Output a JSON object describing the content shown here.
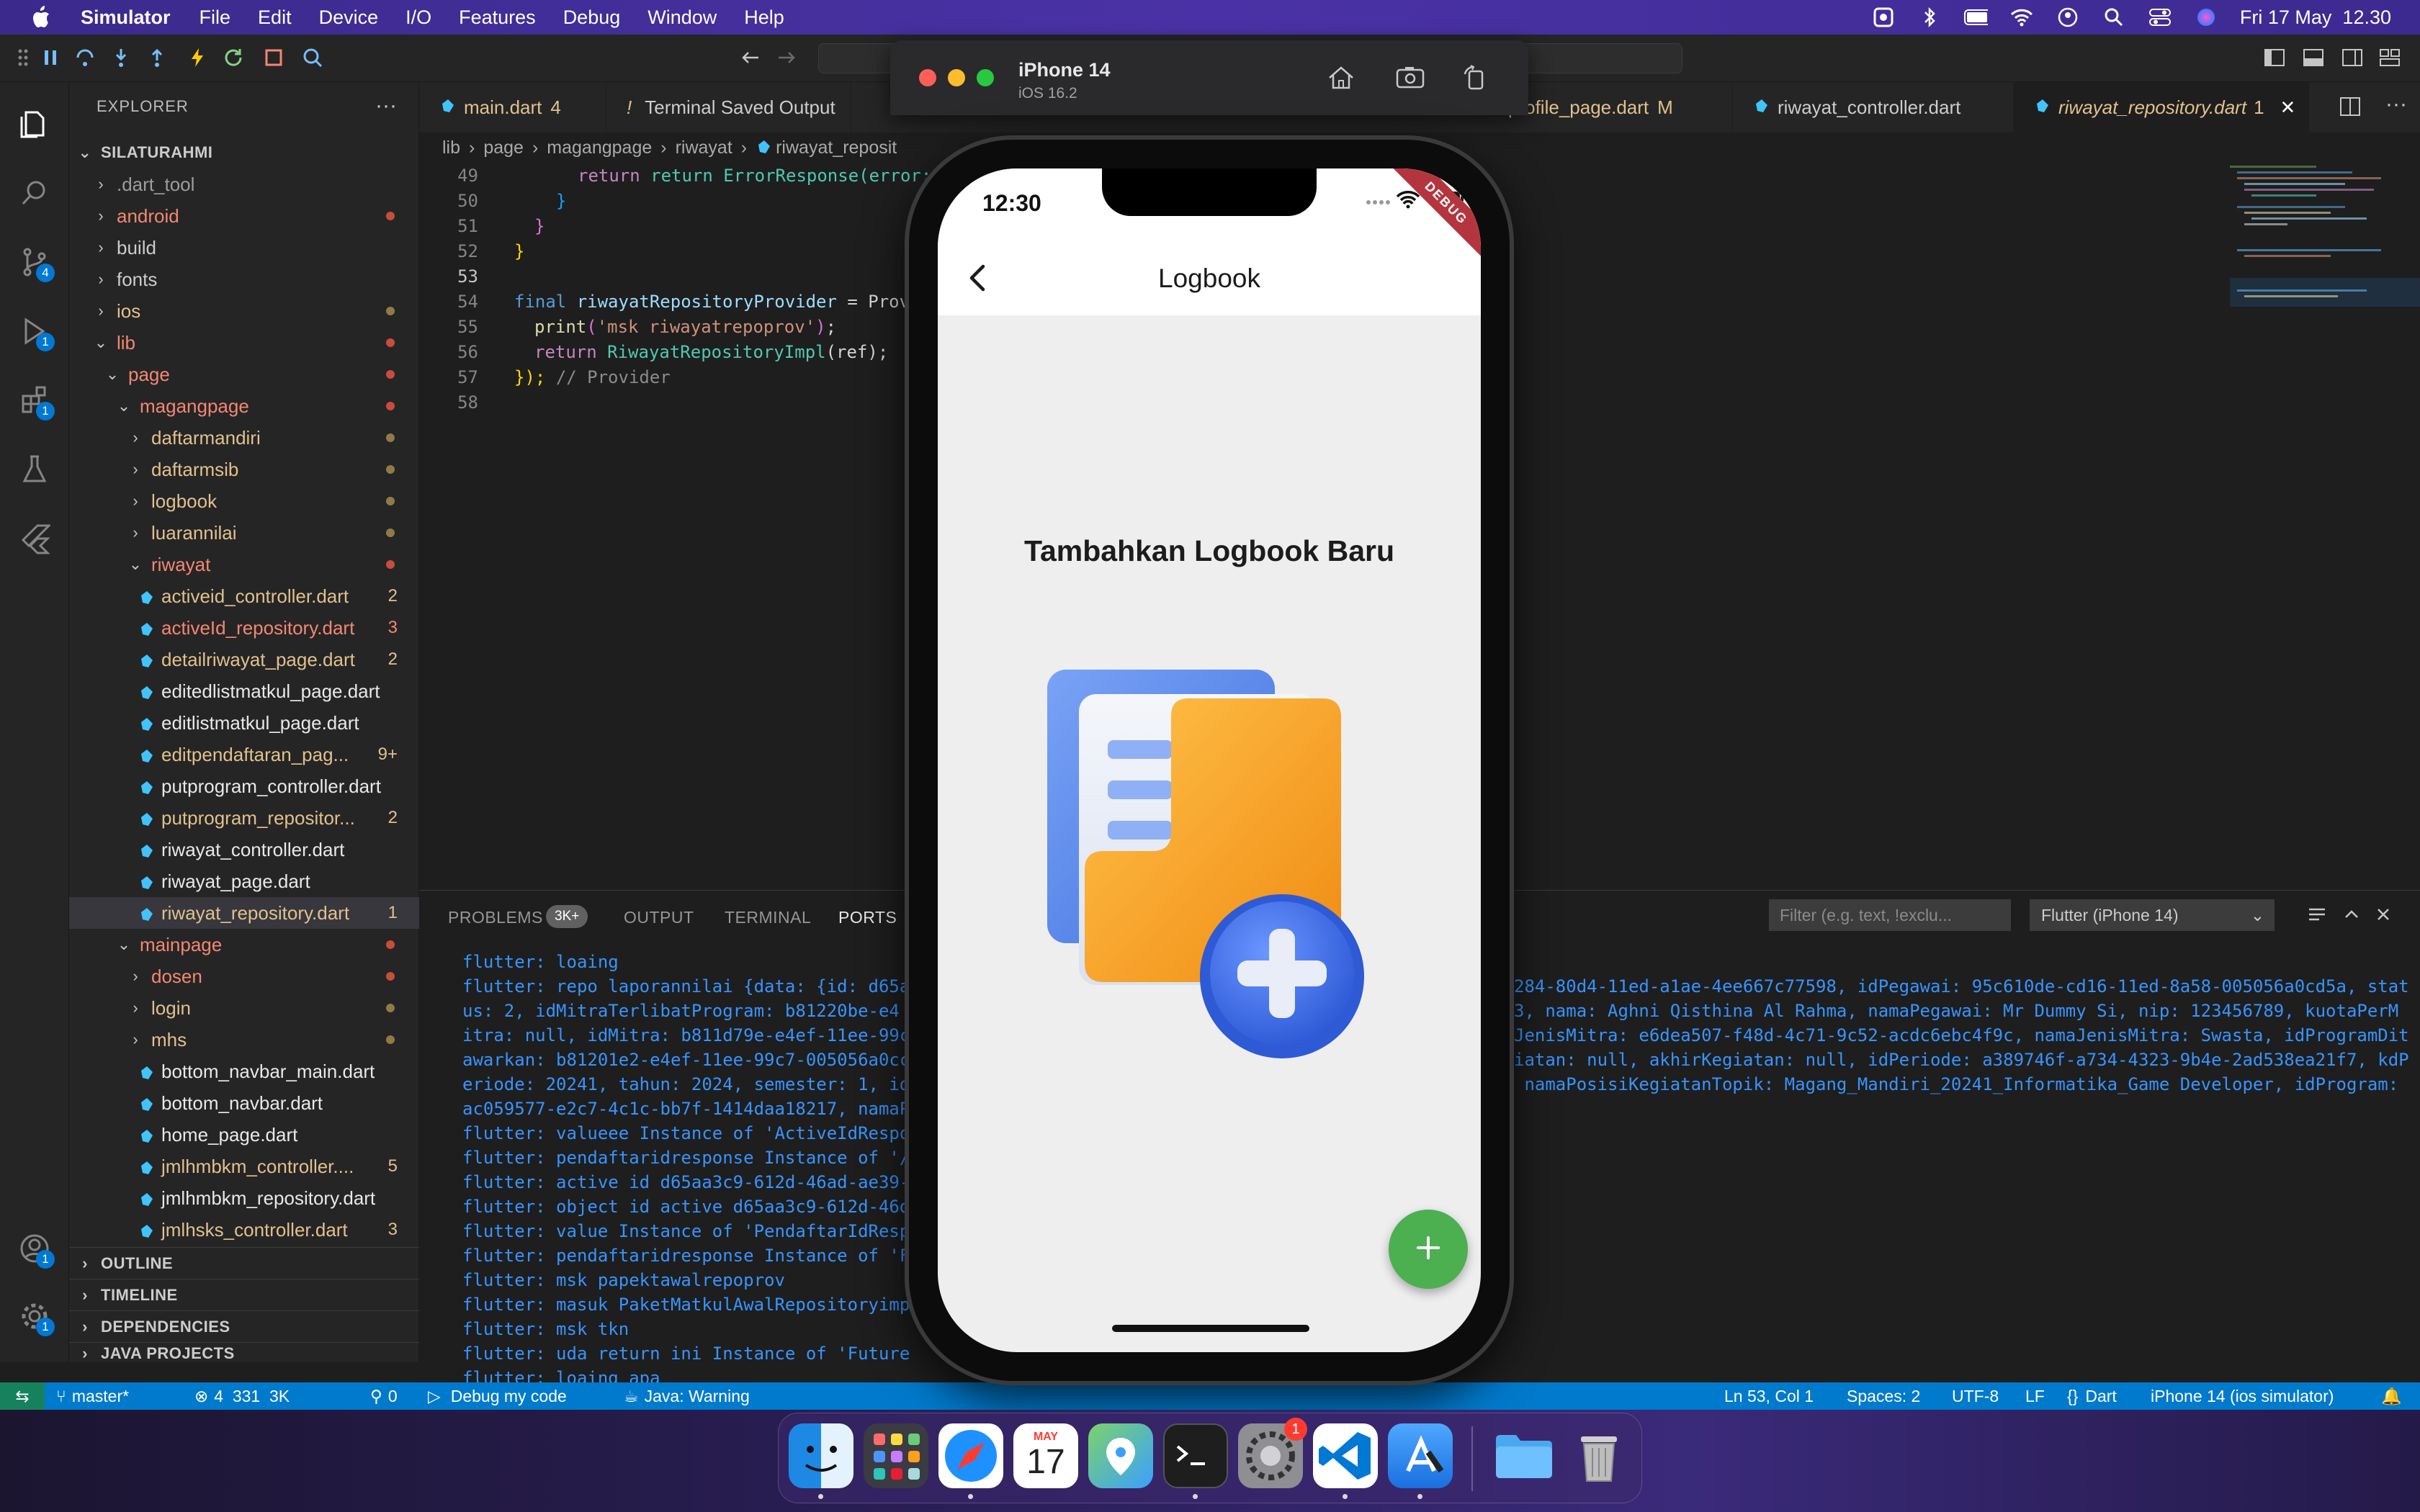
{
  "menubar": {
    "app_name": "Simulator",
    "items": [
      "File",
      "Edit",
      "Device",
      "I/O",
      "Features",
      "Debug",
      "Window",
      "Help"
    ],
    "datetime": "Fri 17 May  12.30"
  },
  "explorer": {
    "title": "EXPLORER",
    "root": "SILATURAHMI",
    "rows": [
      {
        "label": ".dart_tool",
        "mark": ""
      },
      {
        "label": "android",
        "mark": ""
      },
      {
        "label": "build",
        "mark": ""
      },
      {
        "label": "fonts",
        "mark": ""
      },
      {
        "label": "ios",
        "mark": ""
      },
      {
        "label": "lib",
        "mark": ""
      },
      {
        "label": "page",
        "mark": ""
      },
      {
        "label": "magangpage",
        "mark": ""
      },
      {
        "label": "daftarmandiri",
        "mark": ""
      },
      {
        "label": "daftarmsib",
        "mark": ""
      },
      {
        "label": "logbook",
        "mark": ""
      },
      {
        "label": "luarannilai",
        "mark": ""
      },
      {
        "label": "riwayat",
        "mark": ""
      },
      {
        "label": "activeid_controller.dart",
        "mark": "2"
      },
      {
        "label": "activeId_repository.dart",
        "mark": "3"
      },
      {
        "label": "detailriwayat_page.dart",
        "mark": "2"
      },
      {
        "label": "editedlistmatkul_page.dart",
        "mark": ""
      },
      {
        "label": "editlistmatkul_page.dart",
        "mark": ""
      },
      {
        "label": "editpendaftaran_pag...",
        "mark": "9+"
      },
      {
        "label": "putprogram_controller.dart",
        "mark": ""
      },
      {
        "label": "putprogram_repositor...",
        "mark": "2"
      },
      {
        "label": "riwayat_controller.dart",
        "mark": ""
      },
      {
        "label": "riwayat_page.dart",
        "mark": ""
      },
      {
        "label": "riwayat_repository.dart",
        "mark": "1"
      },
      {
        "label": "mainpage",
        "mark": ""
      },
      {
        "label": "dosen",
        "mark": ""
      },
      {
        "label": "login",
        "mark": ""
      },
      {
        "label": "mhs",
        "mark": ""
      },
      {
        "label": "bottom_navbar_main.dart",
        "mark": ""
      },
      {
        "label": "bottom_navbar.dart",
        "mark": ""
      },
      {
        "label": "home_page.dart",
        "mark": ""
      },
      {
        "label": "jmlhmbkm_controller....",
        "mark": "5"
      },
      {
        "label": "jmlhmbkm_repository.dart",
        "mark": ""
      },
      {
        "label": "jmlhsks_controller.dart",
        "mark": "3"
      }
    ],
    "sections": [
      "OUTLINE",
      "TIMELINE",
      "DEPENDENCIES",
      "JAVA PROJECTS"
    ]
  },
  "activity_badges": {
    "scm": "4",
    "run": "1",
    "extensions": "1",
    "accounts": "1",
    "manage": "1"
  },
  "tabs": [
    {
      "label": "main.dart",
      "mark": "4"
    },
    {
      "label": "Terminal Saved Output",
      "mark": ""
    },
    {
      "label": "profile_page.dart",
      "mark": "M"
    },
    {
      "label": "riwayat_controller.dart",
      "mark": ""
    },
    {
      "label": "riwayat_repository.dart",
      "mark": "1"
    }
  ],
  "breadcrumb": [
    "lib",
    "page",
    "magangpage",
    "riwayat",
    "riwayat_reposit"
  ],
  "code": {
    "line_numbers": [
      "49",
      "50",
      "51",
      "52",
      "53",
      "54",
      "55",
      "56",
      "57",
      "58"
    ],
    "line_49": "return ErrorResponse(error: ex.e",
    "line_50": "}",
    "line_51": "}",
    "line_52": "}",
    "line_54_kw": "final",
    "line_54_name": "riwayatRepositoryProvider",
    "line_54_rest": " = Prov",
    "line_55_fn": "print",
    "line_55_str": "'msk riwayatrepoprov'",
    "line_56_kw": "return",
    "line_56_cls": "RiwayatRepositoryImpl",
    "line_56_rest": "(ref);",
    "line_57_close": "});",
    "line_57_comment": "// Provider"
  },
  "panel": {
    "tabs": [
      "PROBLEMS",
      "OUTPUT",
      "TERMINAL",
      "PORTS"
    ],
    "problems_count": "3K+",
    "filter_placeholder": "Filter (e.g. text, !exclu...",
    "target": "Flutter (iPhone 14)",
    "lines_left": [
      "flutter: loaing",
      "flutter: repo laporannilai {data: {id: d65a",
      "us: 2, idMitraTerlibatProgram: b81220be-e4",
      "itra: null, idMitra: b811d79e-e4ef-11ee-99c",
      "awarkan: b81201e2-e4ef-11ee-99c7-005056a0cc",
      "eriode: 20241, tahun: 2024, semester: 1, id",
      "ac059577-e2c7-4c1c-bb7f-1414daa18217, namaP",
      "flutter: valueee Instance of 'ActiveIdRespo",
      "flutter: pendaftaridresponse Instance of '/",
      "flutter: active id d65aa3c9-612d-46ad-ae39-",
      "flutter: object id active d65aa3c9-612d-46d",
      "flutter: value Instance of 'PendaftarIdResp",
      "flutter: pendaftaridresponse Instance of 'F",
      "flutter: msk papektawalrepoprov",
      "flutter: masuk PaketMatkulAwalRepositoryimp",
      "flutter: msk tkn",
      "flutter: uda return ini Instance of 'Future",
      "flutter: loaing apa"
    ],
    "lines_right": [
      "",
      "284-80d4-11ed-a1ae-4ee667c77598, idPegawai: 95c610de-cd16-11ed-8a58-005056a0cd5a, stat",
      "3, nama: Aghni Qisthina Al Rahma, namaPegawai: Mr Dummy Si, nip: 123456789, kuotaPerM",
      "JenisMitra: e6dea507-f48d-4c71-9c52-acdc6ebc4f9c, namaJenisMitra: Swasta, idProgramDit",
      "iatan: null, akhirKegiatan: null, idPeriode: a389746f-a734-4323-9b4e-2ad538ea21f7, kdP",
      " namaPosisiKegiatanTopik: Magang_Mandiri_20241_Informatika_Game Developer, idProgram:"
    ]
  },
  "statusbar": {
    "branch": "master*",
    "problems": "4  331  3K",
    "ports": "0",
    "debug": "Debug my code",
    "java": "Java: Warning",
    "position": "Ln 53, Col 1",
    "spaces": "Spaces: 2",
    "encoding": "UTF-8",
    "eol": "LF",
    "language": "Dart",
    "device": "iPhone 14 (ios simulator)"
  },
  "simulator": {
    "device_name": "iPhone 14",
    "os": "iOS 16.2"
  },
  "phone": {
    "time": "12:30",
    "debug_banner": "DEBUG",
    "appbar_title": "Logbook",
    "empty_title": "Tambahkan Logbook Baru",
    "fab_icon": "plus-icon",
    "colors": {
      "fab": "#4caf50",
      "folder": "#f5a623",
      "doc": "#5b8def"
    }
  },
  "dock": {
    "calendar_month": "MAY",
    "calendar_day": "17",
    "settings_badge": "1"
  }
}
